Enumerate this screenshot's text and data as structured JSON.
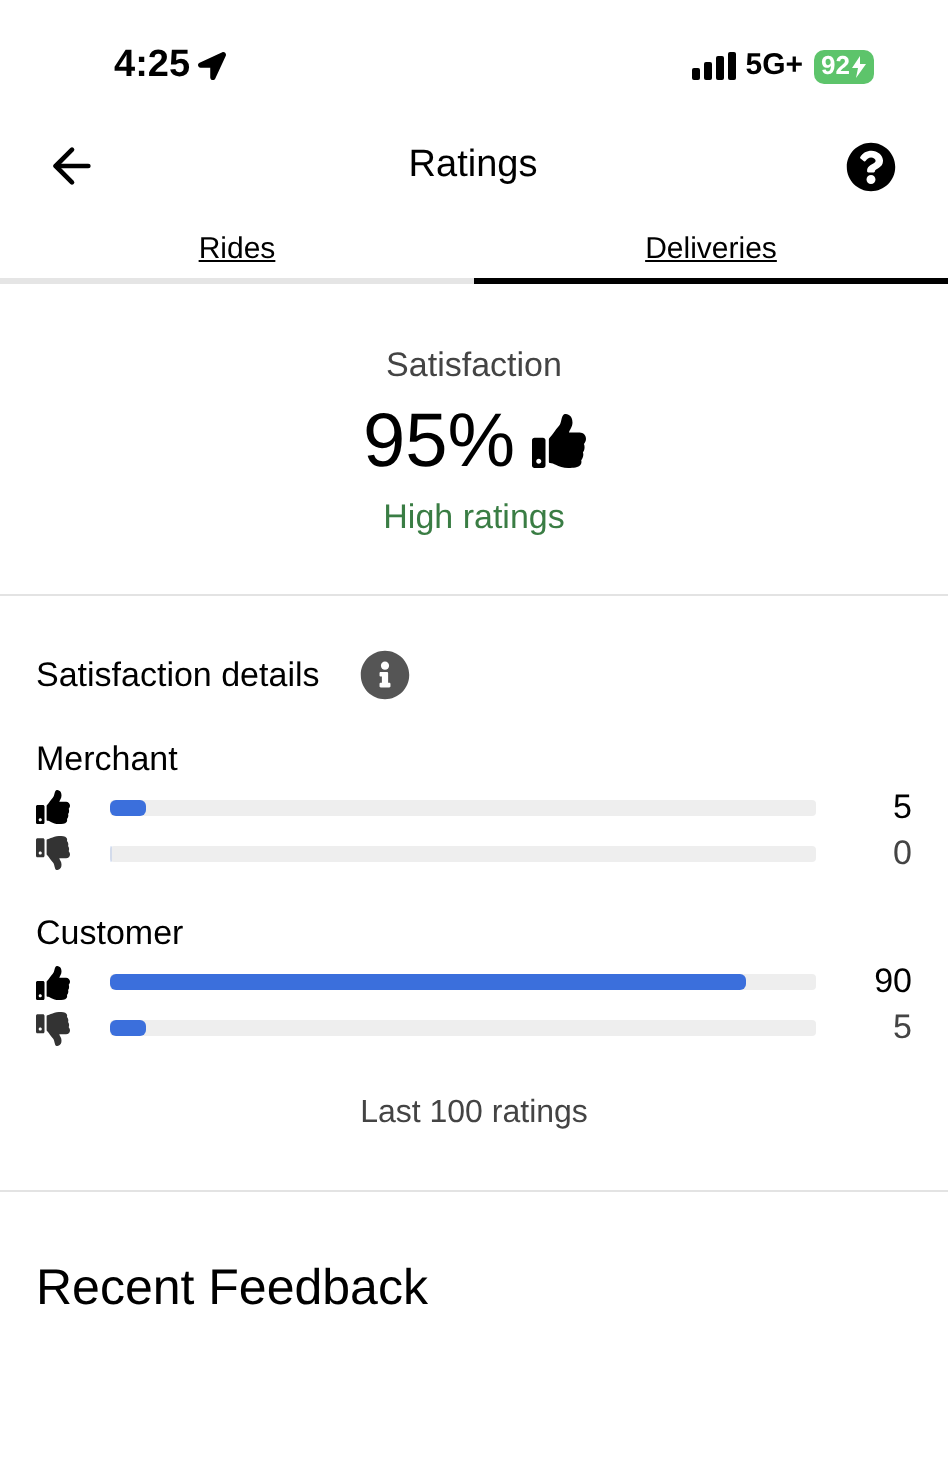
{
  "status_bar": {
    "time": "4:25",
    "network": "5G+",
    "battery": "92"
  },
  "header": {
    "title": "Ratings"
  },
  "tabs": [
    {
      "label": "Rides",
      "selected": false
    },
    {
      "label": "Deliveries",
      "selected": true
    }
  ],
  "satisfaction": {
    "label": "Satisfaction",
    "value": "95%",
    "verdict": "High ratings"
  },
  "details": {
    "title": "Satisfaction details",
    "groups": [
      {
        "name": "Merchant",
        "rows": [
          {
            "kind": "up",
            "level": 0.05,
            "count": "5"
          },
          {
            "kind": "down",
            "level": 0,
            "count": "0"
          }
        ]
      },
      {
        "name": "Customer",
        "rows": [
          {
            "kind": "up",
            "level": 0.9,
            "count": "90"
          },
          {
            "kind": "down",
            "level": 0.05,
            "count": "5"
          }
        ]
      }
    ],
    "footer": "Last 100 ratings"
  },
  "recent": {
    "title": "Recent Feedback"
  }
}
